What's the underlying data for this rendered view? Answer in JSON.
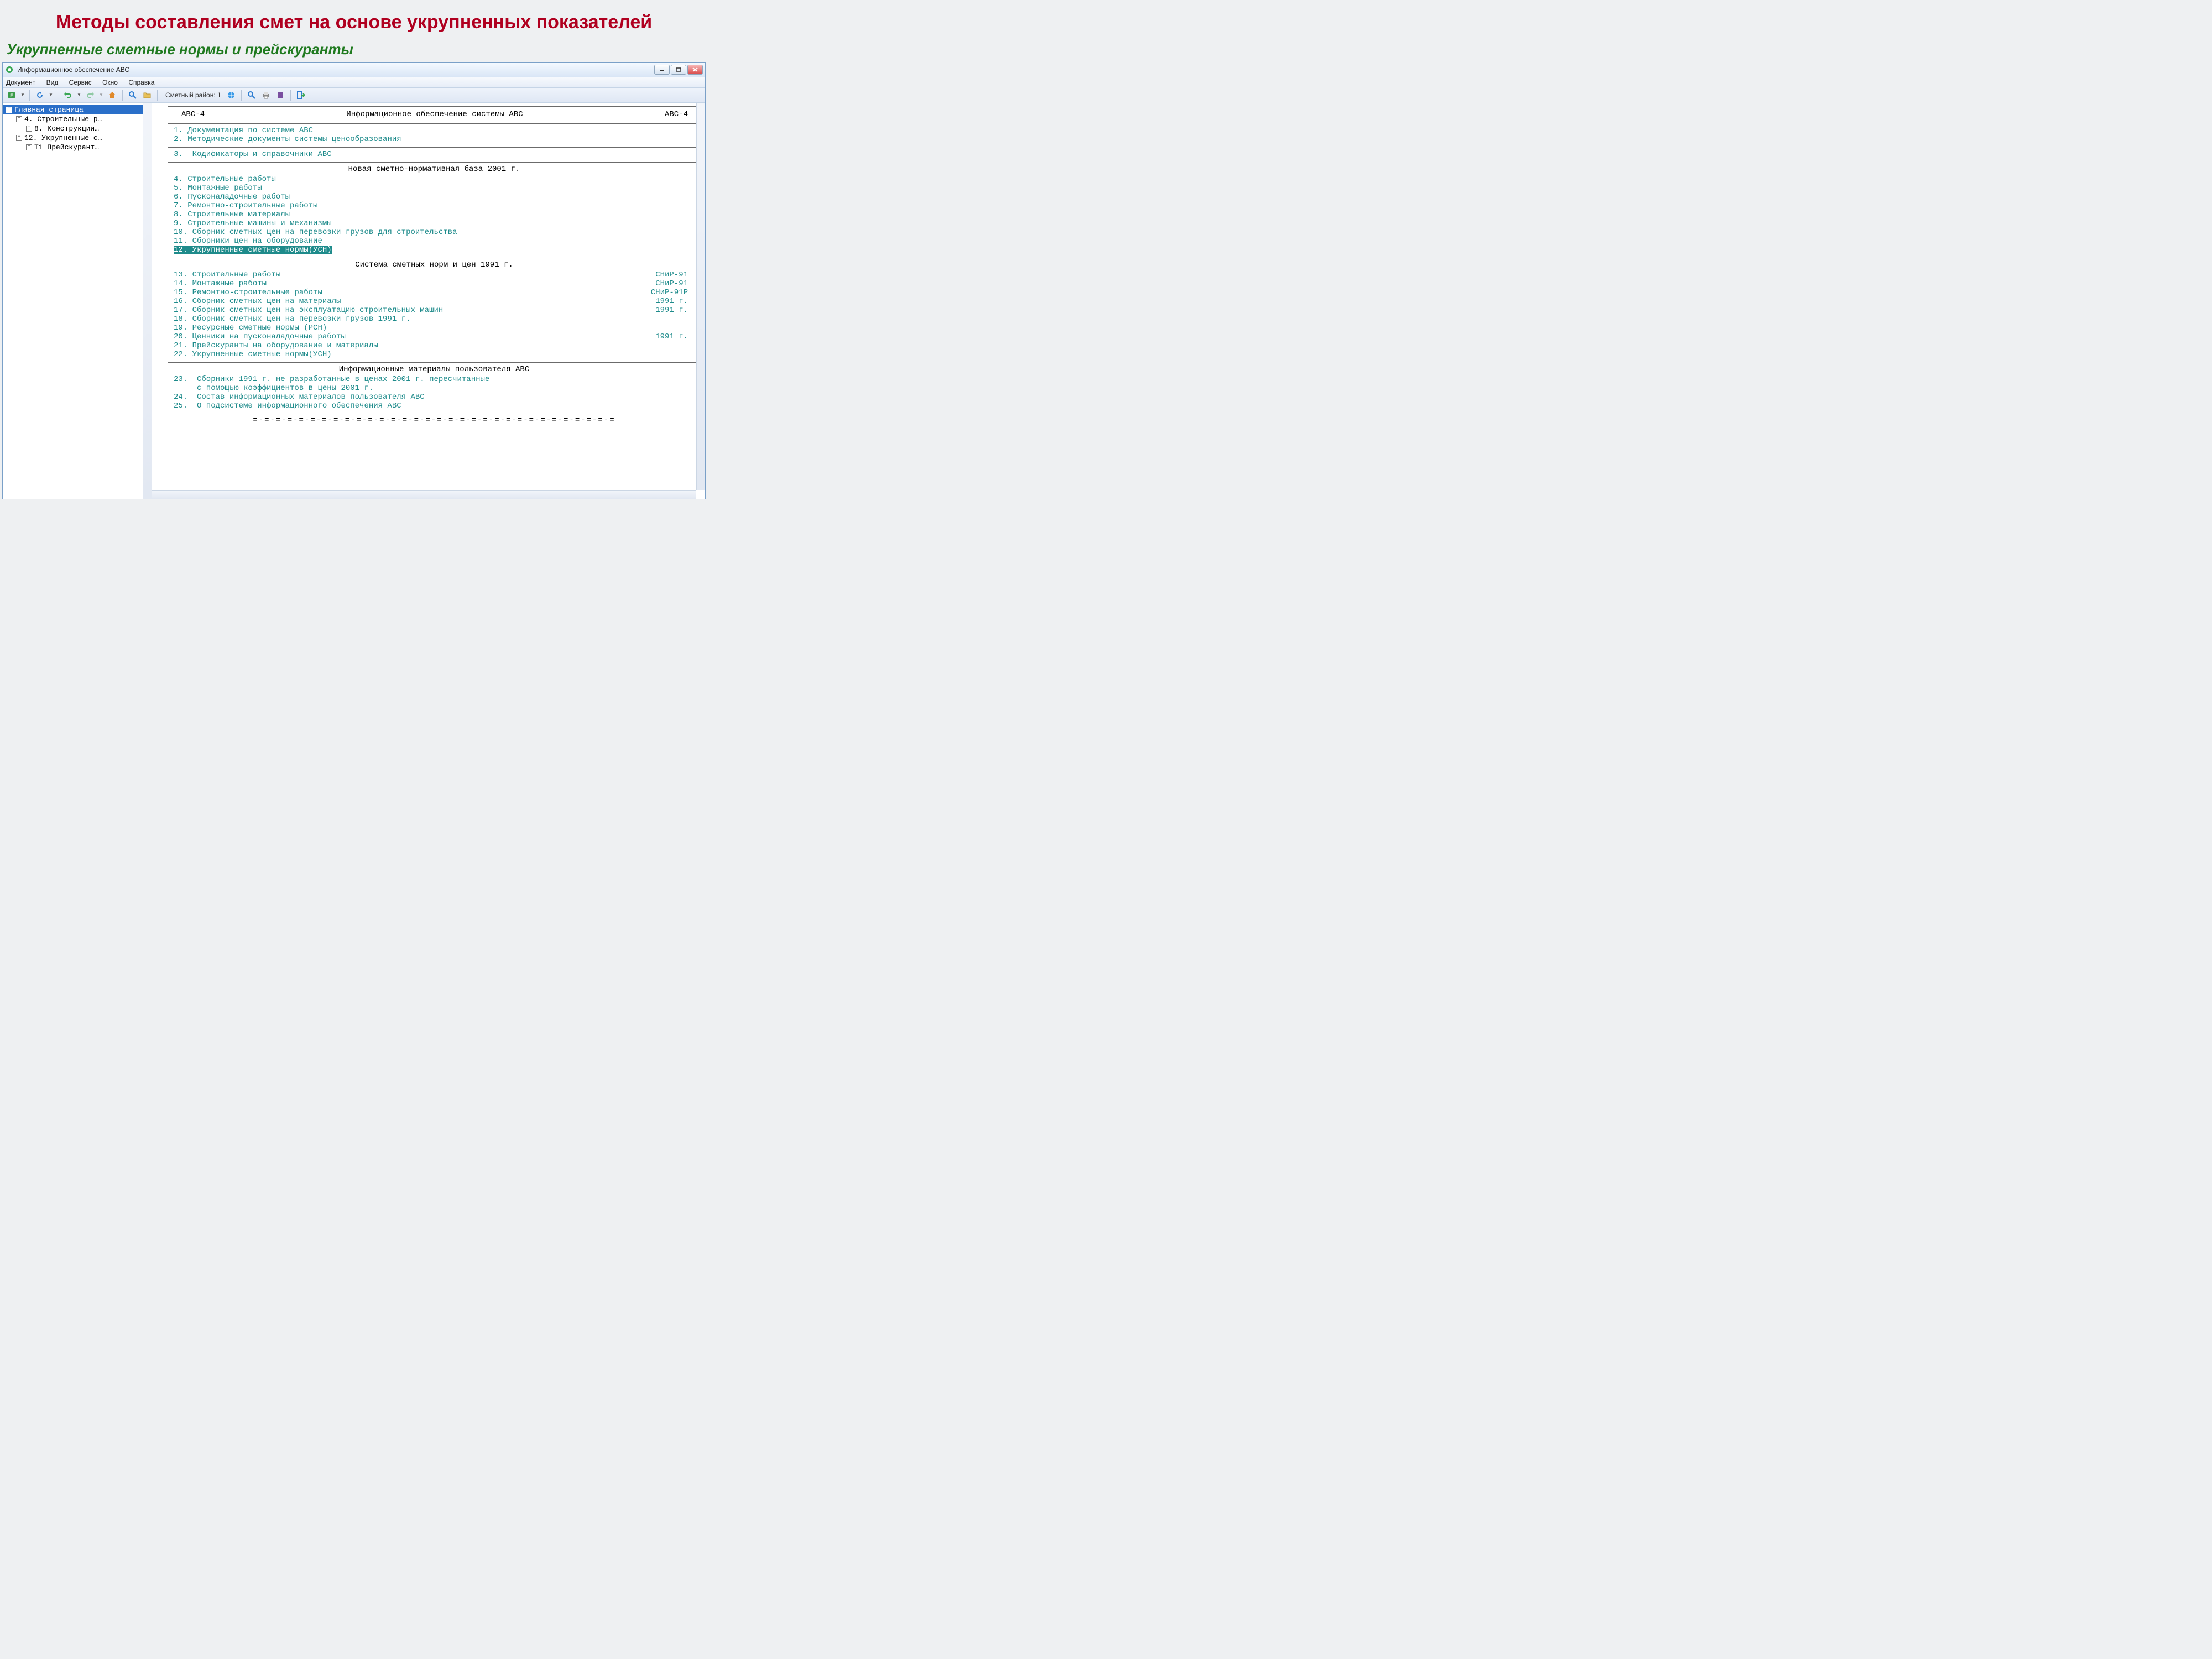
{
  "slide": {
    "title": "Методы составления смет на основе укрупненных показателей",
    "subtitle": "Укрупненные сметные нормы и прейскуранты"
  },
  "window": {
    "title": "Информационное обеспечение АВС",
    "menu": [
      "Документ",
      "Вид",
      "Сервис",
      "Окно",
      "Справка"
    ],
    "toolbar_region_label": "Сметный район: 1"
  },
  "tree": {
    "root": "Главная страница",
    "items": [
      {
        "label": "4. Строительные р…",
        "indent": 1
      },
      {
        "label": "8. Конструкции…",
        "indent": 2
      },
      {
        "label": "12. Укрупненные с…",
        "indent": 1
      },
      {
        "label": "Т1 Прейскурант…",
        "indent": 2
      }
    ]
  },
  "doc": {
    "header_left": "АВС-4",
    "header_center": "Информационное обеспечение системы АВС",
    "header_right": "АВС-4",
    "section1": [
      "1. Документация по системе АВС",
      "2. Методические документы системы ценообразования"
    ],
    "section2": [
      "3.  Кодификаторы и справочники АВС"
    ],
    "section3_title": "Новая сметно-нормативная база 2001 г.",
    "section3": [
      "4. Строительные работы",
      "5. Монтажные работы",
      "6. Пусконаладочные работы",
      "7. Ремонтно-строительные работы",
      "8. Строительные материалы",
      "9. Строительные машины и механизмы",
      "10. Сборник сметных цен на перевозки грузов для строительства",
      "11. Сборники цен на оборудование"
    ],
    "section3_selected": "12. Укрупненные сметные нормы(УСН)",
    "section4_title": "Система сметных норм и цен 1991 г.",
    "section4": [
      {
        "l": "13. Строительные работы",
        "r": "СНиР-91"
      },
      {
        "l": "14. Монтажные работы",
        "r": "СНиР-91"
      },
      {
        "l": "15. Ремонтно-строительные работы",
        "r": "СНиР-91Р"
      },
      {
        "l": "16. Сборник сметных цен на материалы",
        "r": "1991 г."
      },
      {
        "l": "17. Сборник сметных цен на эксплуатацию строительных машин",
        "r": "1991 г."
      },
      {
        "l": "18. Сборник сметных цен на перевозки грузов 1991 г.",
        "r": ""
      },
      {
        "l": "19. Ресурсные сметные нормы (РСН)",
        "r": ""
      },
      {
        "l": "20. Ценники на пусконаладочные работы",
        "r": "1991 г."
      },
      {
        "l": "21. Прейскуранты на оборудование и материалы",
        "r": ""
      },
      {
        "l": "22. Укрупненные сметные нормы(УСН)",
        "r": ""
      }
    ],
    "section5_title": "Информационные материалы пользователя АВС",
    "section5": [
      "23.  Сборники 1991 г. не разработанные в ценах 2001 г. пересчитанные",
      "     с помощью коэффициентов в цены 2001 г.",
      "24.  Состав информационных материалов пользователя АВС",
      "25.  О подсистеме информационного обеспечения АВС"
    ],
    "dashes": "=-=-=-=-=-=-=-=-=-=-=-=-=-=-=-=-=-=-=-=-=-=-=-=-=-=-=-=-=-=-=-="
  }
}
